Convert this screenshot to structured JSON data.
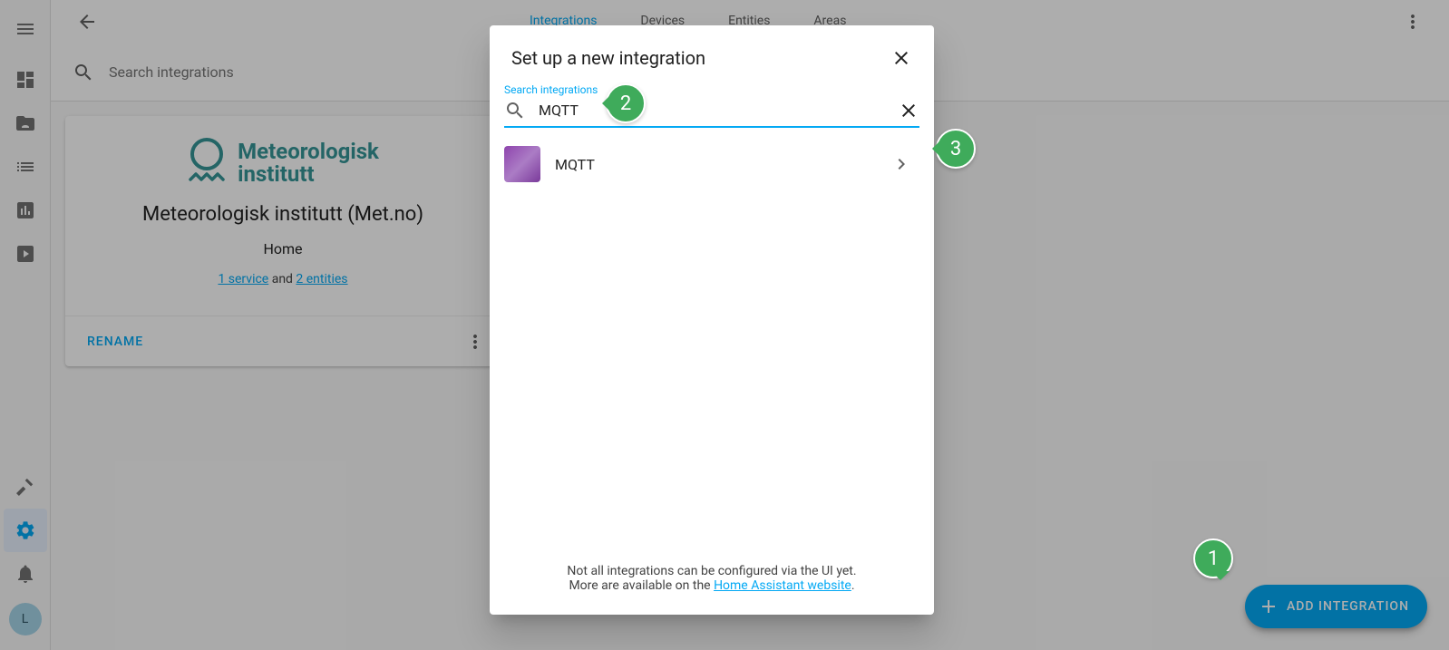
{
  "sidebar": {
    "avatar_letter": "L"
  },
  "header": {
    "tabs": [
      "Integrations",
      "Devices",
      "Entities",
      "Areas"
    ],
    "active_tab": 0
  },
  "search": {
    "placeholder": "Search integrations"
  },
  "integration_card": {
    "logo_line1": "Meteorologisk",
    "logo_line2": "institutt",
    "title": "Meteorologisk institutt (Met.no)",
    "subtitle": "Home",
    "service_link": "1 service",
    "link_joiner": " and ",
    "entities_link": "2 entities",
    "rename_label": "RENAME"
  },
  "fab": {
    "label": "ADD INTEGRATION"
  },
  "modal": {
    "title": "Set up a new integration",
    "search_label": "Search integrations",
    "search_value": "MQTT",
    "results": [
      {
        "name": "MQTT"
      }
    ],
    "footer_line1": "Not all integrations can be configured via the UI yet.",
    "footer_line2a": "More are available on the ",
    "footer_link": "Home Assistant website",
    "footer_line2b": "."
  },
  "annotations": {
    "one": "1",
    "two": "2",
    "three": "3"
  }
}
